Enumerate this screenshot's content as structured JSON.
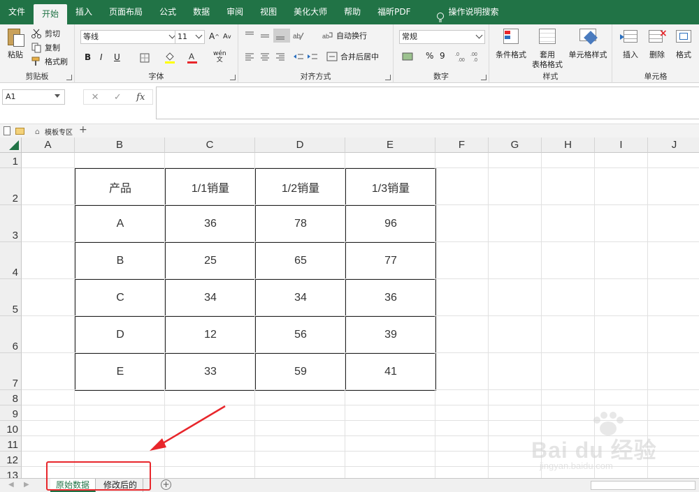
{
  "menu": {
    "items": [
      "文件",
      "开始",
      "插入",
      "页面布局",
      "公式",
      "数据",
      "审阅",
      "视图",
      "美化大师",
      "帮助",
      "福昕PDF"
    ],
    "active_index": 1,
    "search_label": "操作说明搜索"
  },
  "ribbon": {
    "clipboard": {
      "paste": "粘贴",
      "cut": "剪切",
      "copy": "复制",
      "format_painter": "格式刷",
      "label": "剪贴板"
    },
    "font": {
      "family": "等线",
      "size": "11",
      "grow": "A",
      "shrink": "A",
      "bold": "B",
      "italic": "I",
      "underline": "U",
      "wen": "wén",
      "label": "字体"
    },
    "alignment": {
      "wrap": "自动换行",
      "merge": "合并后居中",
      "label": "对齐方式"
    },
    "number": {
      "format": "常规",
      "percent": "%",
      "comma": "9",
      "label": "数字"
    },
    "styles": {
      "conditional": "条件格式",
      "table_line1": "套用",
      "table_line2": "表格格式",
      "cell_styles": "单元格样式",
      "label": "样式"
    },
    "cells": {
      "insert": "插入",
      "delete": "删除",
      "format": "格式",
      "label": "单元格"
    }
  },
  "formula_bar": {
    "name_box": "A1",
    "fx": "fx",
    "value": ""
  },
  "template_bar": {
    "label": "模板专区"
  },
  "columns": [
    "A",
    "B",
    "C",
    "D",
    "E",
    "F",
    "G",
    "H",
    "I",
    "J"
  ],
  "rows": [
    "1",
    "2",
    "3",
    "4",
    "5",
    "6",
    "7",
    "8",
    "9",
    "10",
    "11",
    "12",
    "13"
  ],
  "table": {
    "headers": [
      "产品",
      "1/1销量",
      "1/2销量",
      "1/3销量"
    ],
    "rows": [
      [
        "A",
        "36",
        "78",
        "96"
      ],
      [
        "B",
        "25",
        "65",
        "77"
      ],
      [
        "C",
        "34",
        "34",
        "36"
      ],
      [
        "D",
        "12",
        "56",
        "39"
      ],
      [
        "E",
        "33",
        "59",
        "41"
      ]
    ]
  },
  "sheets": {
    "tabs": [
      "原始数据",
      "修改后的"
    ],
    "active_index": 0
  },
  "watermark": {
    "text": "Bai du 经验",
    "url": "jingyan.baidu.com"
  },
  "colors": {
    "accent": "#217346",
    "annotation": "#e8262b"
  }
}
